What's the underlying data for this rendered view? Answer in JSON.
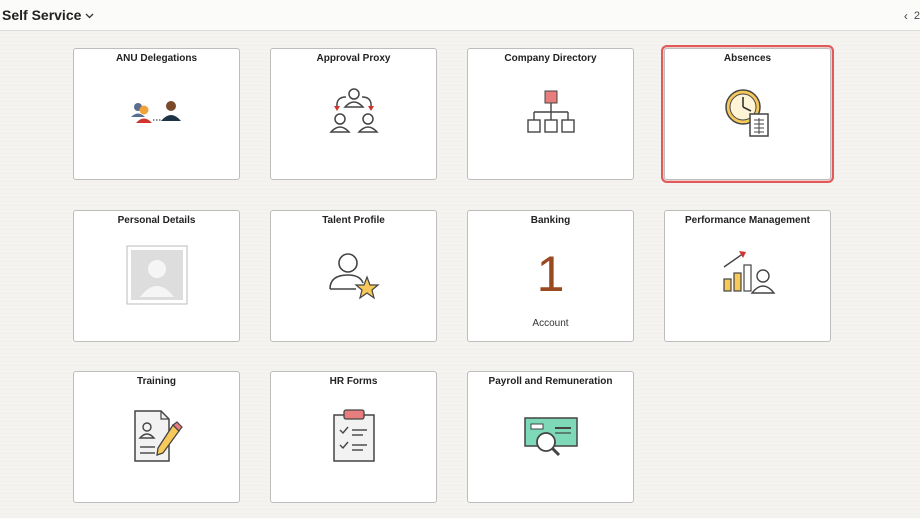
{
  "header": {
    "title": "Self Service",
    "pager_text": "2"
  },
  "tiles": [
    {
      "title": "ANU Delegations",
      "icon": "delegations-icon"
    },
    {
      "title": "Approval Proxy",
      "icon": "approval-proxy-icon"
    },
    {
      "title": "Company Directory",
      "icon": "org-chart-icon"
    },
    {
      "title": "Absences",
      "icon": "clock-document-icon",
      "selected": true
    },
    {
      "title": "Personal Details",
      "icon": "avatar-placeholder-icon"
    },
    {
      "title": "Talent Profile",
      "icon": "person-star-icon"
    },
    {
      "title": "Banking",
      "count": "1",
      "count_label": "Account"
    },
    {
      "title": "Performance Management",
      "icon": "growth-chart-person-icon"
    },
    {
      "title": "Training",
      "icon": "document-pencil-icon"
    },
    {
      "title": "HR Forms",
      "icon": "clipboard-checklist-icon"
    },
    {
      "title": "Payroll and Remuneration",
      "icon": "cheque-magnifier-icon"
    }
  ],
  "colors": {
    "selected_outline": "#e05a5a",
    "count_color": "#9a4a20"
  }
}
